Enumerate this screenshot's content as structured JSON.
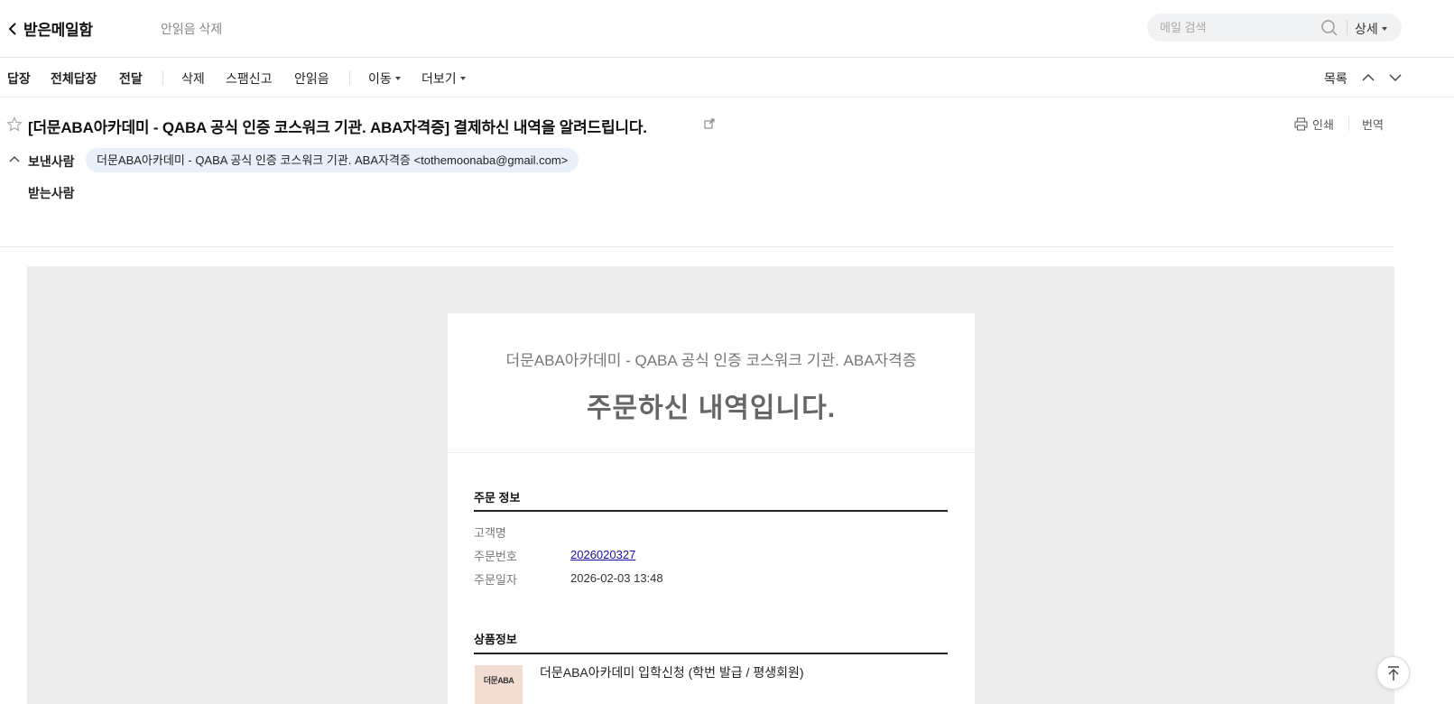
{
  "header": {
    "back_label": "받은메일함",
    "unread_delete": "안읽음 삭제",
    "search_placeholder": "메일 검색",
    "search_detail": "상세"
  },
  "toolbar": {
    "reply": "답장",
    "reply_all": "전체답장",
    "forward": "전달",
    "delete": "삭제",
    "spam": "스팸신고",
    "mark_unread": "안읽음",
    "move": "이동",
    "more": "더보기",
    "list": "목록"
  },
  "mail": {
    "subject": "[더문ABA아카데미 - QABA 공식 인증 코스워크 기관. ABA자격증] 결제하신 내역을 알려드립니다.",
    "print": "인쇄",
    "translate": "번역",
    "from_label": "보낸사람",
    "from_value": "더문ABA아카데미 - QABA 공식 인증 코스워크 기관. ABA자격증 <tothemoonaba@gmail.com>",
    "to_label": "받는사람"
  },
  "content": {
    "brand": "더문ABA아카데미 - QABA 공식 인증 코스워크 기관. ABA자격증",
    "headline": "주문하신 내역입니다.",
    "order_section": "주문 정보",
    "customer_label": "고객명",
    "customer_value": "",
    "order_no_label": "주문번호",
    "order_no_value": "2026020327",
    "order_date_label": "주문일자",
    "order_date_value": "2026-02-03 13:48",
    "product_section": "상품정보",
    "product_thumb_text": "더문ABA",
    "product_name": "더문ABA아카데미 입학신청 (학번 발급 / 평생회원)"
  },
  "icons": {
    "back": "chevron-left-icon",
    "search": "search-icon",
    "star": "star-icon",
    "external": "external-link-icon",
    "print": "printer-icon",
    "prev": "chevron-up-icon",
    "next": "chevron-down-icon",
    "scroll_top": "arrow-up-icon"
  },
  "colors": {
    "chip_bg": "#e8f0fb",
    "body_bg": "#ededed",
    "link": "#1a0dab"
  }
}
